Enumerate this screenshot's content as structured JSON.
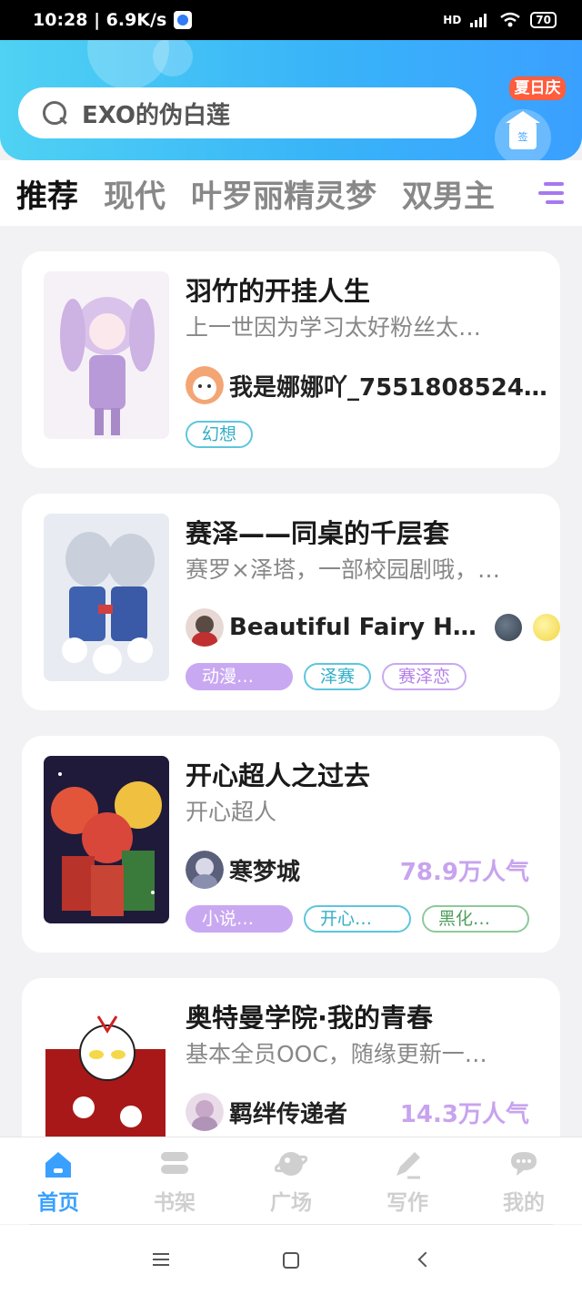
{
  "status": {
    "time_speed": "10:28 | 6.9K/s",
    "network": "HD",
    "battery": "70"
  },
  "header": {
    "search_text": "EXO的伪白莲",
    "checkin_badge": "夏日庆",
    "checkin_label": "签"
  },
  "tabs": [
    {
      "label": "推荐"
    },
    {
      "label": "现代"
    },
    {
      "label": "叶罗丽精灵梦"
    },
    {
      "label": "双男主"
    }
  ],
  "cards": [
    {
      "title": "羽竹的开挂人生",
      "desc": "上一世因为学习太好粉丝太…",
      "author": "我是娜娜吖_75518085244…",
      "popularity": "",
      "tags": [
        "幻想"
      ]
    },
    {
      "title": "赛泽——同桌的千层套",
      "desc": "赛罗×泽塔，一部校园剧哦，…",
      "author": "Beautiful Fairy Huo.",
      "popularity": "",
      "tags": [
        "动漫…",
        "泽赛",
        "赛泽恋"
      ]
    },
    {
      "title": "开心超人之过去",
      "desc": "开心超人",
      "author": "寒梦城",
      "popularity": "78.9万人气",
      "tags": [
        "小说…",
        "开心…",
        "黑化…"
      ]
    },
    {
      "title": "奥特曼学院·我的青春",
      "desc": "基本全员OOC，随缘更新一…",
      "author": "羁绊传递者",
      "popularity": "14.3万人气",
      "tags": []
    }
  ],
  "nav": [
    {
      "label": "首页",
      "icon": "home-icon"
    },
    {
      "label": "书架",
      "icon": "bookshelf-icon"
    },
    {
      "label": "广场",
      "icon": "planet-icon"
    },
    {
      "label": "写作",
      "icon": "pen-icon"
    },
    {
      "label": "我的",
      "icon": "chat-bubble-icon"
    }
  ],
  "colors": {
    "accent": "#3aa0ff",
    "tab_indicator": "#a678f0",
    "popularity": "#c8a3ee"
  }
}
